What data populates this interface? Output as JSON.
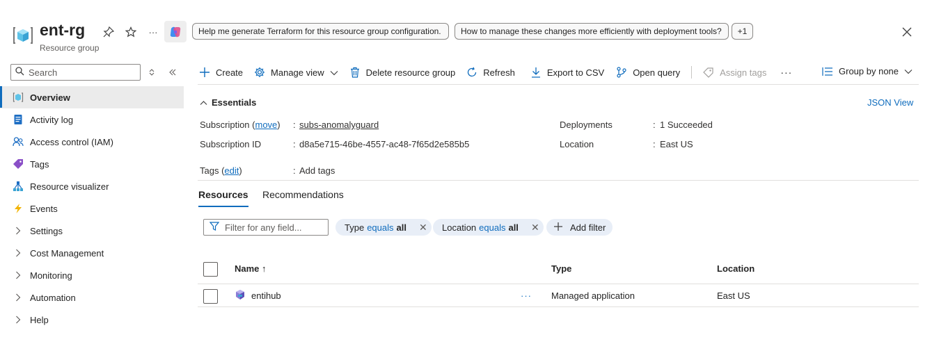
{
  "header": {
    "title": "ent-rg",
    "subtitle": "Resource group",
    "more": "···",
    "prompt_chips": [
      "Help me generate Terraform for this resource group configuration.",
      "How to manage these changes more efficiently with deployment tools?",
      "+1"
    ]
  },
  "sidebar": {
    "search_placeholder": "Search",
    "items": [
      {
        "label": "Overview",
        "icon": "resource-group-icon",
        "active": true
      },
      {
        "label": "Activity log",
        "icon": "activity-log-icon"
      },
      {
        "label": "Access control (IAM)",
        "icon": "people-icon"
      },
      {
        "label": "Tags",
        "icon": "tag-icon"
      },
      {
        "label": "Resource visualizer",
        "icon": "visualizer-icon"
      },
      {
        "label": "Events",
        "icon": "lightning-icon"
      },
      {
        "label": "Settings",
        "icon": "chevron-right-icon"
      },
      {
        "label": "Cost Management",
        "icon": "chevron-right-icon"
      },
      {
        "label": "Monitoring",
        "icon": "chevron-right-icon"
      },
      {
        "label": "Automation",
        "icon": "chevron-right-icon"
      },
      {
        "label": "Help",
        "icon": "chevron-right-icon"
      }
    ]
  },
  "toolbar": {
    "create": "Create",
    "manage_view": "Manage view",
    "delete": "Delete resource group",
    "refresh": "Refresh",
    "export": "Export to CSV",
    "open_query": "Open query",
    "assign_tags": "Assign tags",
    "more": "···",
    "group_by": "Group by none"
  },
  "essentials": {
    "title": "Essentials",
    "json_view": "JSON View",
    "subscription_label": "Subscription (",
    "subscription_move": "move",
    "subscription_label_end": ")",
    "subscription_value": "subs-anomalyguard",
    "subscription_id_label": "Subscription ID",
    "subscription_id_value": "d8a5e715-46be-4557-ac48-7f65d2e585b5",
    "deployments_label": "Deployments",
    "deployments_value": "1 Succeeded",
    "location_label": "Location",
    "location_value": "East US",
    "tags_label": "Tags (",
    "tags_edit": "edit",
    "tags_label_end": ")",
    "tags_value": "Add tags",
    "colon": ":"
  },
  "tabs": [
    "Resources",
    "Recommendations"
  ],
  "filters": {
    "placeholder": "Filter for any field...",
    "pills": [
      {
        "field": "Type",
        "op": "equals",
        "value": "all"
      },
      {
        "field": "Location",
        "op": "equals",
        "value": "all"
      }
    ],
    "add_filter": "Add filter"
  },
  "table": {
    "columns": [
      "Name ↑",
      "Type",
      "Location"
    ],
    "rows": [
      {
        "name": "entihub",
        "more": "···",
        "type": "Managed application",
        "location": "East US"
      }
    ]
  },
  "colors": {
    "accent": "#0f6cbd",
    "pill_bg": "#e8eef7",
    "active_nav_bg": "#ebebeb"
  }
}
